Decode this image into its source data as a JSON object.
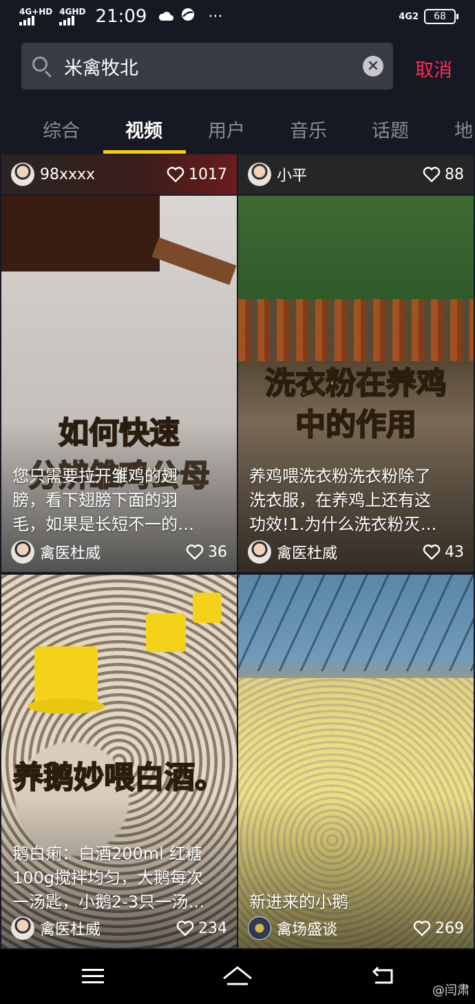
{
  "status_bar": {
    "network_1": "4G+HD",
    "network_2": "4GHD",
    "time": "21:09",
    "icons": [
      "cloud-icon",
      "browser-icon"
    ],
    "more": "···",
    "sim2_label": "4G2",
    "battery": "68"
  },
  "search": {
    "query": "米禽牧北",
    "cancel_label": "取消"
  },
  "tabs": [
    {
      "label": "综合",
      "active": false
    },
    {
      "label": "视频",
      "active": true
    },
    {
      "label": "用户",
      "active": false
    },
    {
      "label": "音乐",
      "active": false
    },
    {
      "label": "话题",
      "active": false
    },
    {
      "label": "地",
      "active": false
    }
  ],
  "top_row": [
    {
      "author": "98xxxx",
      "likes": "1017"
    },
    {
      "author": "小平",
      "likes": "88"
    }
  ],
  "videos": [
    {
      "overlay_title": "如何快速",
      "overlay_title_2": "分辨雏鸡公母",
      "desc_lines": [
        "您只需要拉开雏鸡的翅",
        "膀，看下翅膀下面的羽",
        "毛，如果是长短不一的…"
      ],
      "author": "禽医杜威",
      "likes": "36"
    },
    {
      "overlay_title": "洗衣粉在养鸡",
      "overlay_title_2": "中的作用",
      "desc_lines": [
        "养鸡喂洗衣粉洗衣粉除了",
        "洗衣服，在养鸡上还有这",
        "功效!1.为什么洗衣粉灭…"
      ],
      "author": "禽医杜威",
      "likes": "43"
    },
    {
      "overlay_title": "养鹅妙喂白酒。",
      "desc_lines": [
        "鹅白痢：白酒200ml 红糖",
        "100g搅拌均匀，大鹅每次",
        "一汤匙，小鹅2-3只一汤…"
      ],
      "author": "禽医杜威",
      "likes": "234"
    },
    {
      "desc_lines": [
        "新进来的小鹅"
      ],
      "author": "禽场盛谈",
      "likes": "269"
    }
  ],
  "nav": {
    "buttons": [
      "menu-icon",
      "home-icon",
      "back-icon"
    ]
  },
  "watermark": "@闫肃",
  "colors": {
    "background": "#161823",
    "accent": "#fe2c55",
    "tab_indicator": "#face15",
    "overlay_text": "#fbe14a"
  }
}
